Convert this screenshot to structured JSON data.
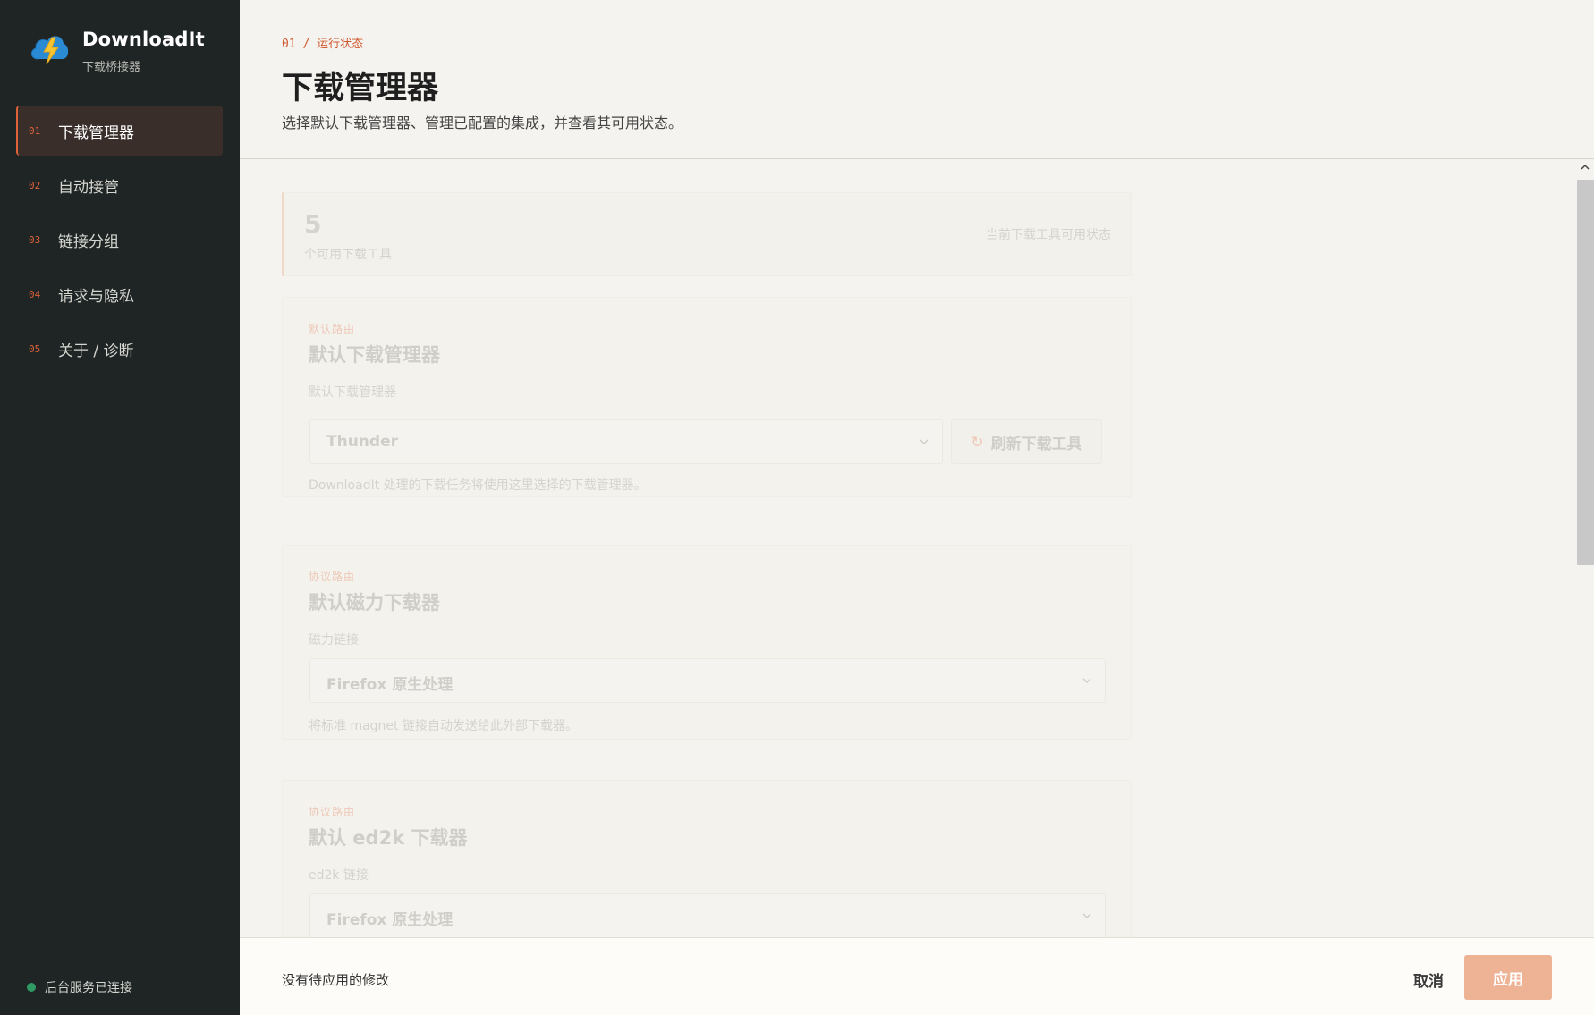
{
  "brand": {
    "name": "DownloadIt",
    "subtitle": "下载桥接器",
    "logo_icon": "cloud-lightning-icon"
  },
  "sidebar": {
    "items": [
      {
        "num": "01",
        "label": "下载管理器",
        "active": true
      },
      {
        "num": "02",
        "label": "自动接管",
        "active": false
      },
      {
        "num": "03",
        "label": "链接分组",
        "active": false
      },
      {
        "num": "04",
        "label": "请求与隐私",
        "active": false
      },
      {
        "num": "05",
        "label": "关于 / 诊断",
        "active": false
      }
    ],
    "status": {
      "text": "后台服务已连接",
      "color": "#2f9a63"
    }
  },
  "header": {
    "breadcrumb_num": "01 /",
    "breadcrumb_label": "运行状态",
    "title": "下载管理器",
    "description": "选择默认下载管理器、管理已配置的集成，并查看其可用状态。"
  },
  "stat": {
    "count": "5",
    "label": "个可用下载工具",
    "note": "当前下载工具可用状态"
  },
  "cards": {
    "default": {
      "eyebrow": "默认路由",
      "title": "默认下载管理器",
      "field_label": "默认下载管理器",
      "value": "Thunder",
      "refresh_label": "刷新下载工具",
      "help": "DownloadIt 处理的下载任务将使用这里选择的下载管理器。"
    },
    "magnet": {
      "eyebrow": "协议路由",
      "title": "默认磁力下载器",
      "field_label": "磁力链接",
      "value": "Firefox 原生处理",
      "help": "将标准 magnet 链接自动发送给此外部下载器。"
    },
    "ed2k": {
      "eyebrow": "协议路由",
      "title": "默认 ed2k 下载器",
      "field_label": "ed2k 链接",
      "value": "Firefox 原生处理"
    }
  },
  "footer": {
    "status": "没有待应用的修改",
    "cancel_label": "取消",
    "apply_label": "应用"
  },
  "colors": {
    "accent": "#e0623a",
    "sidebar_bg": "#1f2525",
    "apply_bg": "#eeb295"
  }
}
